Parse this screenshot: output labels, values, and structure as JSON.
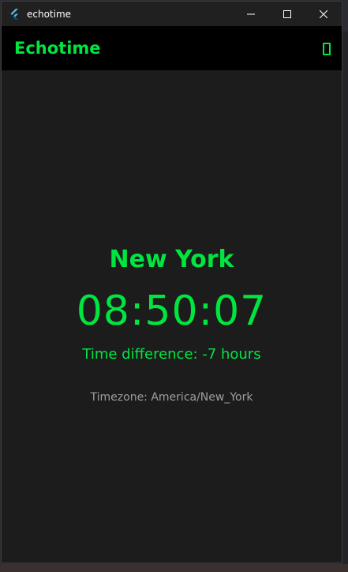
{
  "window": {
    "title": "echotime",
    "icon": "flutter-icon",
    "controls": [
      "minimize-icon",
      "maximize-icon",
      "close-icon"
    ]
  },
  "appbar": {
    "title": "Echotime",
    "action_icon": "phone-icon"
  },
  "main": {
    "city": "New York",
    "time": "08:50:07",
    "difference": "Time difference: -7 hours",
    "timezone": "Timezone: America/New_York"
  },
  "colors": {
    "accent": "#00e640",
    "background": "#1c1c1c",
    "appbar": "#000000",
    "muted_text": "#9e9e9e"
  }
}
